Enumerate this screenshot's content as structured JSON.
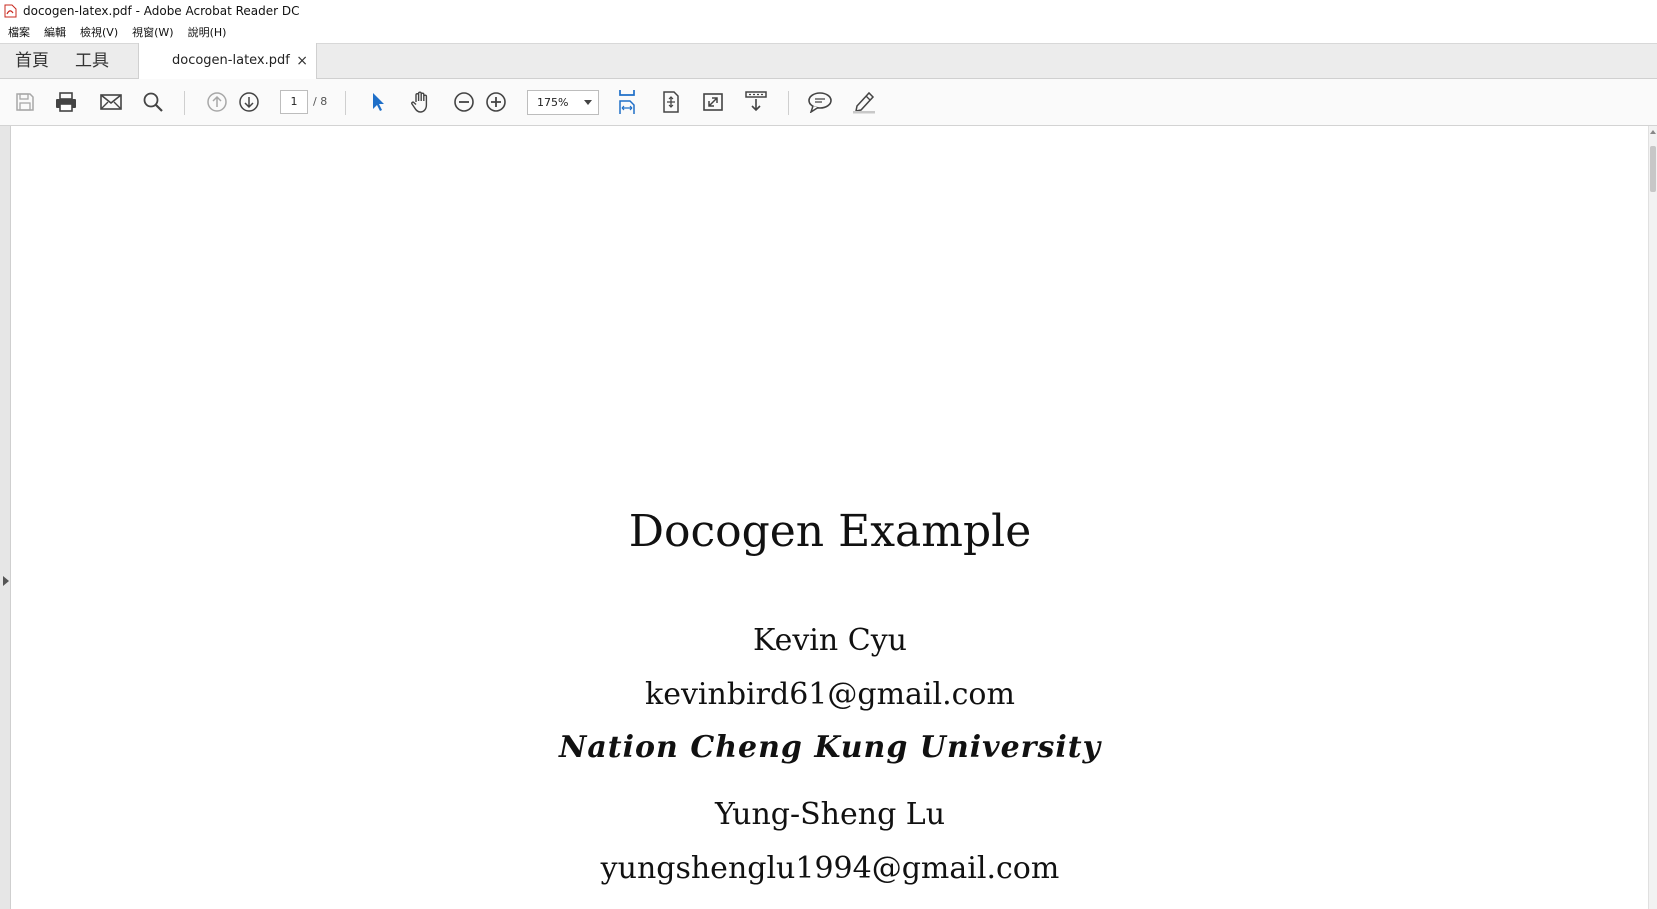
{
  "window": {
    "title": "docogen-latex.pdf - Adobe Acrobat Reader DC"
  },
  "menu": [
    "檔案",
    "編輯",
    "檢視(V)",
    "視窗(W)",
    "說明(H)"
  ],
  "tabs": {
    "home": "首頁",
    "tools": "工具",
    "document": "docogen-latex.pdf",
    "close": "×"
  },
  "toolbar": {
    "page_current": "1",
    "page_total": "/ 8",
    "zoom": "175%",
    "accent_color": "#1f6fc8",
    "icons": [
      "save-icon",
      "print-icon",
      "email-icon",
      "search-icon",
      "page-up-icon",
      "page-down-icon",
      "select-cursor-icon",
      "hand-icon",
      "zoom-out-icon",
      "zoom-in-icon",
      "fit-width-icon",
      "fit-page-icon",
      "fullscreen-icon",
      "read-mode-icon",
      "comment-icon",
      "highlight-pen-icon"
    ]
  },
  "document": {
    "title": "Docogen Example",
    "author1": "Kevin Cyu",
    "email1": "kevinbird61@gmail.com",
    "affiliation": "Nation Cheng Kung University",
    "author2": "Yung-Sheng Lu",
    "email2": "yungshenglu1994@gmail.com"
  }
}
